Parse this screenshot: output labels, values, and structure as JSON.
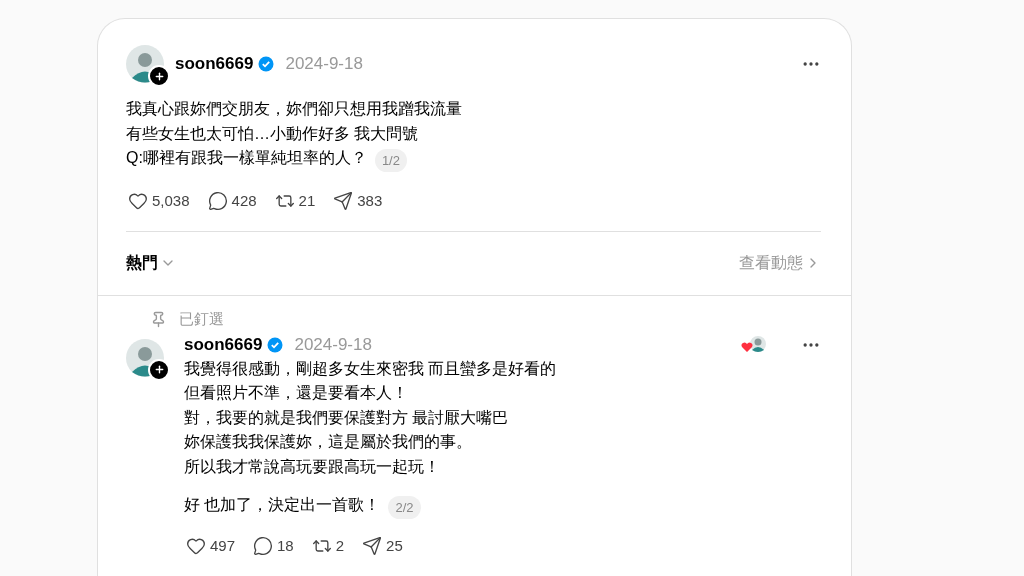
{
  "post": {
    "username": "soon6669",
    "verified": true,
    "date": "2024-9-18",
    "lines": [
      "我真心跟妳們交朋友，妳們卻只想用我蹭我流量",
      "有些女生也太可怕…小動作好多 我大問號",
      "Q:哪裡有跟我一樣單純坦率的人？"
    ],
    "page_badge": "1/2",
    "stats": [
      {
        "kind": "like",
        "count": "5,038"
      },
      {
        "kind": "reply",
        "count": "428"
      },
      {
        "kind": "repost",
        "count": "21"
      },
      {
        "kind": "share",
        "count": "383"
      }
    ]
  },
  "sort": {
    "label": "熱門",
    "link": "查看動態"
  },
  "reply": {
    "pinned_label": "已釘選",
    "username": "soon6669",
    "verified": true,
    "date": "2024-9-18",
    "author_liked": true,
    "paragraphs": [
      [
        "我覺得很感動，剛超多女生來密我 而且蠻多是好看的",
        "但看照片不準，還是要看本人！",
        "對，我要的就是我們要保護對方 最討厭大嘴巴",
        "妳保護我我保護妳，這是屬於我們的事。",
        "所以我才常說高玩要跟高玩一起玩！"
      ],
      [
        "好 也加了，決定出一首歌！"
      ]
    ],
    "page_badge": "2/2",
    "stats": [
      {
        "kind": "like",
        "count": "497"
      },
      {
        "kind": "reply",
        "count": "18"
      },
      {
        "kind": "repost",
        "count": "2"
      },
      {
        "kind": "share",
        "count": "25"
      }
    ]
  }
}
